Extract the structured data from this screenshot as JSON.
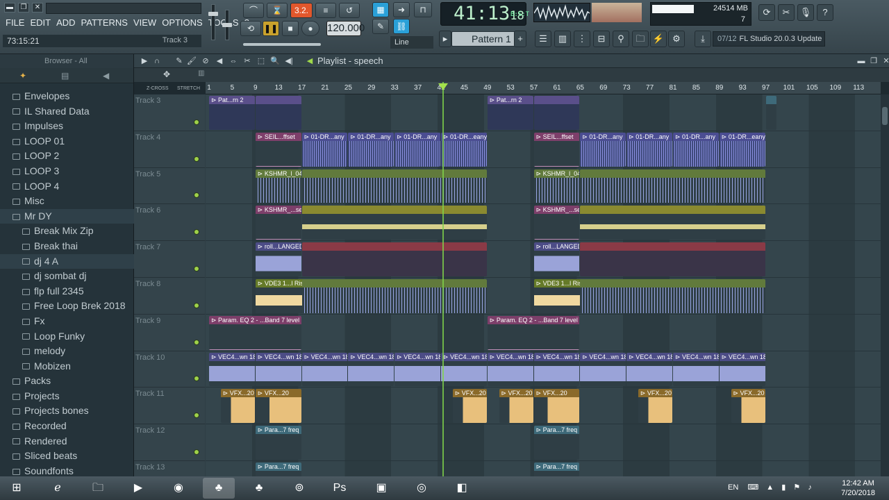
{
  "menu": [
    "FILE",
    "EDIT",
    "ADD",
    "PATTERNS",
    "VIEW",
    "OPTIONS",
    "TOOLS",
    "?"
  ],
  "hint": {
    "time": "73:15:21",
    "target": "Track 3"
  },
  "transport": {
    "tempo": "120.000",
    "time_main": "41:13",
    "time_sub": "18",
    "time_unit": "B:S:T",
    "snap": "Line",
    "rec_label": "3.2."
  },
  "pattern": {
    "name": "Pattern 1"
  },
  "cpu": {
    "ram": "514 MB",
    "voices": "7",
    "cpu_val": "24"
  },
  "news": {
    "index": "07/12",
    "text": "FL Studio 20.0.3 Update"
  },
  "browser": {
    "title": "Browser - All",
    "items": [
      {
        "label": "Envelopes",
        "indent": 1,
        "sel": false
      },
      {
        "label": "IL Shared Data",
        "indent": 1,
        "sel": false
      },
      {
        "label": "Impulses",
        "indent": 1,
        "sel": false
      },
      {
        "label": "LOOP 01",
        "indent": 1,
        "sel": false
      },
      {
        "label": "LOOP 2",
        "indent": 1,
        "sel": false
      },
      {
        "label": "LOOP 3",
        "indent": 1,
        "sel": false
      },
      {
        "label": "LOOP 4",
        "indent": 1,
        "sel": false
      },
      {
        "label": "Misc",
        "indent": 1,
        "sel": false
      },
      {
        "label": "Mr DY",
        "indent": 1,
        "sel": true
      },
      {
        "label": "Break Mix Zip",
        "indent": 2,
        "sel": false
      },
      {
        "label": "Break thai",
        "indent": 2,
        "sel": false
      },
      {
        "label": "dj 4 A",
        "indent": 2,
        "sel": true
      },
      {
        "label": "dj sombat dj",
        "indent": 2,
        "sel": false
      },
      {
        "label": "flp full 2345",
        "indent": 2,
        "sel": false
      },
      {
        "label": "Free Loop Brek 2018",
        "indent": 2,
        "sel": false
      },
      {
        "label": "Fx",
        "indent": 2,
        "sel": false
      },
      {
        "label": "Loop Funky",
        "indent": 2,
        "sel": false
      },
      {
        "label": "melody",
        "indent": 2,
        "sel": false
      },
      {
        "label": "Mobizen",
        "indent": 2,
        "sel": false
      },
      {
        "label": "Packs",
        "indent": 1,
        "sel": false
      },
      {
        "label": "Projects",
        "indent": 1,
        "sel": false
      },
      {
        "label": "Projects bones",
        "indent": 1,
        "sel": false
      },
      {
        "label": "Recorded",
        "indent": 1,
        "sel": false
      },
      {
        "label": "Rendered",
        "indent": 1,
        "sel": false
      },
      {
        "label": "Sliced beats",
        "indent": 1,
        "sel": false
      },
      {
        "label": "Soundfonts",
        "indent": 1,
        "sel": false
      }
    ]
  },
  "playlist": {
    "title": "Playlist - speech",
    "zcross": "Z-CROSS",
    "stretch": "STRETCH",
    "bars": [
      "1",
      "5",
      "9",
      "13",
      "17",
      "21",
      "25",
      "29",
      "33",
      "37",
      "41",
      "45",
      "49",
      "53",
      "57",
      "61",
      "65",
      "69",
      "73",
      "77",
      "81",
      "85",
      "89",
      "93",
      "97",
      "101",
      "105",
      "109",
      "113"
    ],
    "tracks": [
      "Track 3",
      "Track 4",
      "Track 5",
      "Track 6",
      "Track 7",
      "Track 8",
      "Track 9",
      "Track 10",
      "Track 11",
      "Track 12",
      "Track 13"
    ],
    "clips": [
      {
        "row": 0,
        "start": 1,
        "len": 8,
        "label": "Pat...rn 2",
        "style": "purple"
      },
      {
        "row": 0,
        "start": 9,
        "len": 8,
        "label": "",
        "style": "purple"
      },
      {
        "row": 0,
        "start": 49,
        "len": 8,
        "label": "Pat...rn 2",
        "style": "purple"
      },
      {
        "row": 0,
        "start": 57,
        "len": 8,
        "label": "",
        "style": "purple"
      },
      {
        "row": 0,
        "start": 97,
        "len": 2,
        "label": "",
        "style": "teal"
      },
      {
        "row": 1,
        "start": 9,
        "len": 8,
        "label": "SEIL...ffset",
        "style": "pink"
      },
      {
        "row": 1,
        "start": 17,
        "len": 8,
        "label": "01-DR...any",
        "style": "blue"
      },
      {
        "row": 1,
        "start": 25,
        "len": 8,
        "label": "01-DR...any",
        "style": "blue"
      },
      {
        "row": 1,
        "start": 33,
        "len": 8,
        "label": "01-DR...any",
        "style": "blue"
      },
      {
        "row": 1,
        "start": 41,
        "len": 8,
        "label": "01-DR...eany",
        "style": "blue"
      },
      {
        "row": 1,
        "start": 57,
        "len": 8,
        "label": "SEIL...ffset",
        "style": "pink"
      },
      {
        "row": 1,
        "start": 65,
        "len": 8,
        "label": "01-DR...any",
        "style": "blue"
      },
      {
        "row": 1,
        "start": 73,
        "len": 8,
        "label": "01-DR...any",
        "style": "blue"
      },
      {
        "row": 1,
        "start": 81,
        "len": 8,
        "label": "01-DR...any",
        "style": "blue"
      },
      {
        "row": 1,
        "start": 89,
        "len": 8,
        "label": "01-DR...eany",
        "style": "blue"
      },
      {
        "row": 2,
        "start": 9,
        "len": 8,
        "label": "KSHMR_l_04",
        "style": "green"
      },
      {
        "row": 2,
        "start": 17,
        "len": 32,
        "label": "",
        "style": "green"
      },
      {
        "row": 2,
        "start": 57,
        "len": 8,
        "label": "KSHMR_l_04",
        "style": "green"
      },
      {
        "row": 2,
        "start": 65,
        "len": 32,
        "label": "",
        "style": "green"
      },
      {
        "row": 3,
        "start": 9,
        "len": 8,
        "label": "KSHMR_...set",
        "style": "pink"
      },
      {
        "row": 3,
        "start": 17,
        "len": 32,
        "label": "",
        "style": "yellow"
      },
      {
        "row": 3,
        "start": 57,
        "len": 8,
        "label": "KSHMR_...set",
        "style": "pink"
      },
      {
        "row": 3,
        "start": 65,
        "len": 32,
        "label": "",
        "style": "yellow"
      },
      {
        "row": 4,
        "start": 9,
        "len": 8,
        "label": "roll...LANGED",
        "style": "lav"
      },
      {
        "row": 4,
        "start": 17,
        "len": 32,
        "label": "",
        "style": "red"
      },
      {
        "row": 4,
        "start": 57,
        "len": 8,
        "label": "roll...LANGED",
        "style": "lav"
      },
      {
        "row": 4,
        "start": 65,
        "len": 32,
        "label": "",
        "style": "red"
      },
      {
        "row": 5,
        "start": 9,
        "len": 9,
        "label": "VDE3 1...l Riser",
        "style": "lime"
      },
      {
        "row": 5,
        "start": 17,
        "len": 32,
        "label": "",
        "style": "green"
      },
      {
        "row": 5,
        "start": 57,
        "len": 9,
        "label": "VDE3 1...l Riser",
        "style": "lime"
      },
      {
        "row": 5,
        "start": 65,
        "len": 32,
        "label": "",
        "style": "green"
      },
      {
        "row": 6,
        "start": 1,
        "len": 16,
        "label": "Param. EQ 2 - ...Band 7 level",
        "style": "pink"
      },
      {
        "row": 6,
        "start": 49,
        "len": 16,
        "label": "Param. EQ 2 - ...Band 7 level",
        "style": "pink"
      },
      {
        "row": 7,
        "start": 1,
        "len": 8,
        "label": "VEC4...wn 18",
        "style": "lav"
      },
      {
        "row": 7,
        "start": 9,
        "len": 8,
        "label": "VEC4...wn 18",
        "style": "lav"
      },
      {
        "row": 7,
        "start": 17,
        "len": 8,
        "label": "VEC4...wn 18",
        "style": "lav"
      },
      {
        "row": 7,
        "start": 25,
        "len": 8,
        "label": "VEC4...wn 18",
        "style": "lav"
      },
      {
        "row": 7,
        "start": 33,
        "len": 8,
        "label": "VEC4...wn 18",
        "style": "lav"
      },
      {
        "row": 7,
        "start": 41,
        "len": 8,
        "label": "VEC4...wn 18",
        "style": "lav"
      },
      {
        "row": 7,
        "start": 49,
        "len": 8,
        "label": "VEC4...wn 18",
        "style": "lav"
      },
      {
        "row": 7,
        "start": 57,
        "len": 8,
        "label": "VEC4...wn 18",
        "style": "lav"
      },
      {
        "row": 7,
        "start": 65,
        "len": 8,
        "label": "VEC4...wn 18",
        "style": "lav"
      },
      {
        "row": 7,
        "start": 73,
        "len": 8,
        "label": "VEC4...wn 18",
        "style": "lav"
      },
      {
        "row": 7,
        "start": 81,
        "len": 8,
        "label": "VEC4...wn 18",
        "style": "lav"
      },
      {
        "row": 7,
        "start": 89,
        "len": 8,
        "label": "VEC4...wn 18",
        "style": "lav"
      },
      {
        "row": 8,
        "start": 3,
        "len": 6,
        "label": "VFX...20",
        "style": "orange"
      },
      {
        "row": 8,
        "start": 9,
        "len": 8,
        "label": "VFX...20",
        "style": "orange"
      },
      {
        "row": 8,
        "start": 43,
        "len": 6,
        "label": "VFX...20",
        "style": "orange"
      },
      {
        "row": 8,
        "start": 51,
        "len": 6,
        "label": "VFX...20",
        "style": "orange"
      },
      {
        "row": 8,
        "start": 57,
        "len": 8,
        "label": "VFX...20",
        "style": "orange"
      },
      {
        "row": 8,
        "start": 75,
        "len": 6,
        "label": "VFX...20",
        "style": "orange"
      },
      {
        "row": 8,
        "start": 91,
        "len": 6,
        "label": "VFX...20",
        "style": "orange"
      },
      {
        "row": 9,
        "start": 9,
        "len": 8,
        "label": "Para...7 freq",
        "style": "teal"
      },
      {
        "row": 9,
        "start": 57,
        "len": 8,
        "label": "Para...7 freq",
        "style": "teal"
      },
      {
        "row": 10,
        "start": 9,
        "len": 8,
        "label": "Para...7 freq",
        "style": "teal"
      },
      {
        "row": 10,
        "start": 57,
        "len": 8,
        "label": "Para...7 freq",
        "style": "teal"
      }
    ]
  },
  "taskbar": {
    "lang": "EN",
    "time": "12:42 AM",
    "date": "7/20/2018"
  }
}
